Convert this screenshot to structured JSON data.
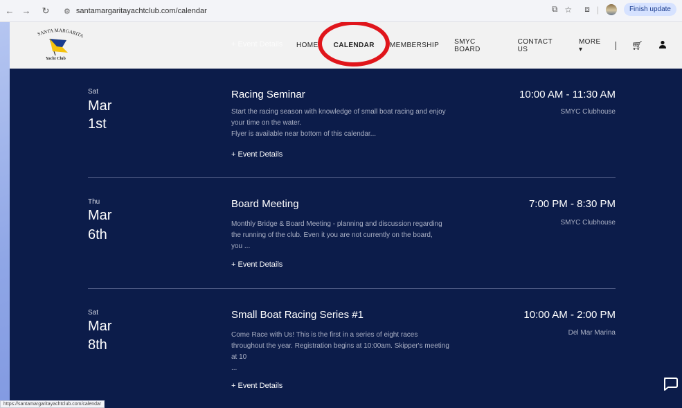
{
  "browser": {
    "url": "santamargaritayachtclub.com/calendar",
    "finish_update": "Finish update",
    "status_url": "https://santamargaritayachtclub.com/calendar"
  },
  "logo": {
    "arc": "SANTA MARGARITA",
    "sub": "Yacht Club"
  },
  "header": {
    "ghost_details": "+ Event Details",
    "menu": [
      "HOME",
      "CALENDAR",
      "MEMBERSHIP",
      "SMYC BOARD",
      "CONTACT US",
      "MORE ▾"
    ],
    "active": "CALENDAR"
  },
  "events": [
    {
      "dow": "Sat",
      "month": "Mar",
      "day": "1st",
      "title": "Racing Seminar",
      "desc": [
        "Start the racing season with knowledge of small boat racing and enjoy",
        "your time on the water.",
        "Flyer is available near bottom of this calendar..."
      ],
      "details": "+ Event Details",
      "time": "10:00 AM - 11:30 AM",
      "location": "SMYC Clubhouse"
    },
    {
      "dow": "Thu",
      "month": "Mar",
      "day": "6th",
      "title": "Board Meeting",
      "desc": [
        "Monthly Bridge & Board Meeting - planning and discussion regarding",
        "the running of the club. Even it you are not currently on the board,",
        "you ..."
      ],
      "details": "+ Event Details",
      "time": "7:00 PM - 8:30 PM",
      "location": "SMYC Clubhouse"
    },
    {
      "dow": "Sat",
      "month": "Mar",
      "day": "8th",
      "title": "Small Boat Racing Series #1",
      "desc": [
        "Come Race with Us! This is the first in a series of eight races",
        "throughout the year. Registration begins at 10:00am. Skipper's meeting",
        "at 10",
        "..."
      ],
      "details": "+ Event Details",
      "time": "10:00 AM - 2:00 PM",
      "location": "Del Mar Marina"
    }
  ],
  "colors": {
    "page_bg": "#0c1c4a",
    "header_bg": "#f2f2f2",
    "highlight_circle": "#e0151b"
  }
}
